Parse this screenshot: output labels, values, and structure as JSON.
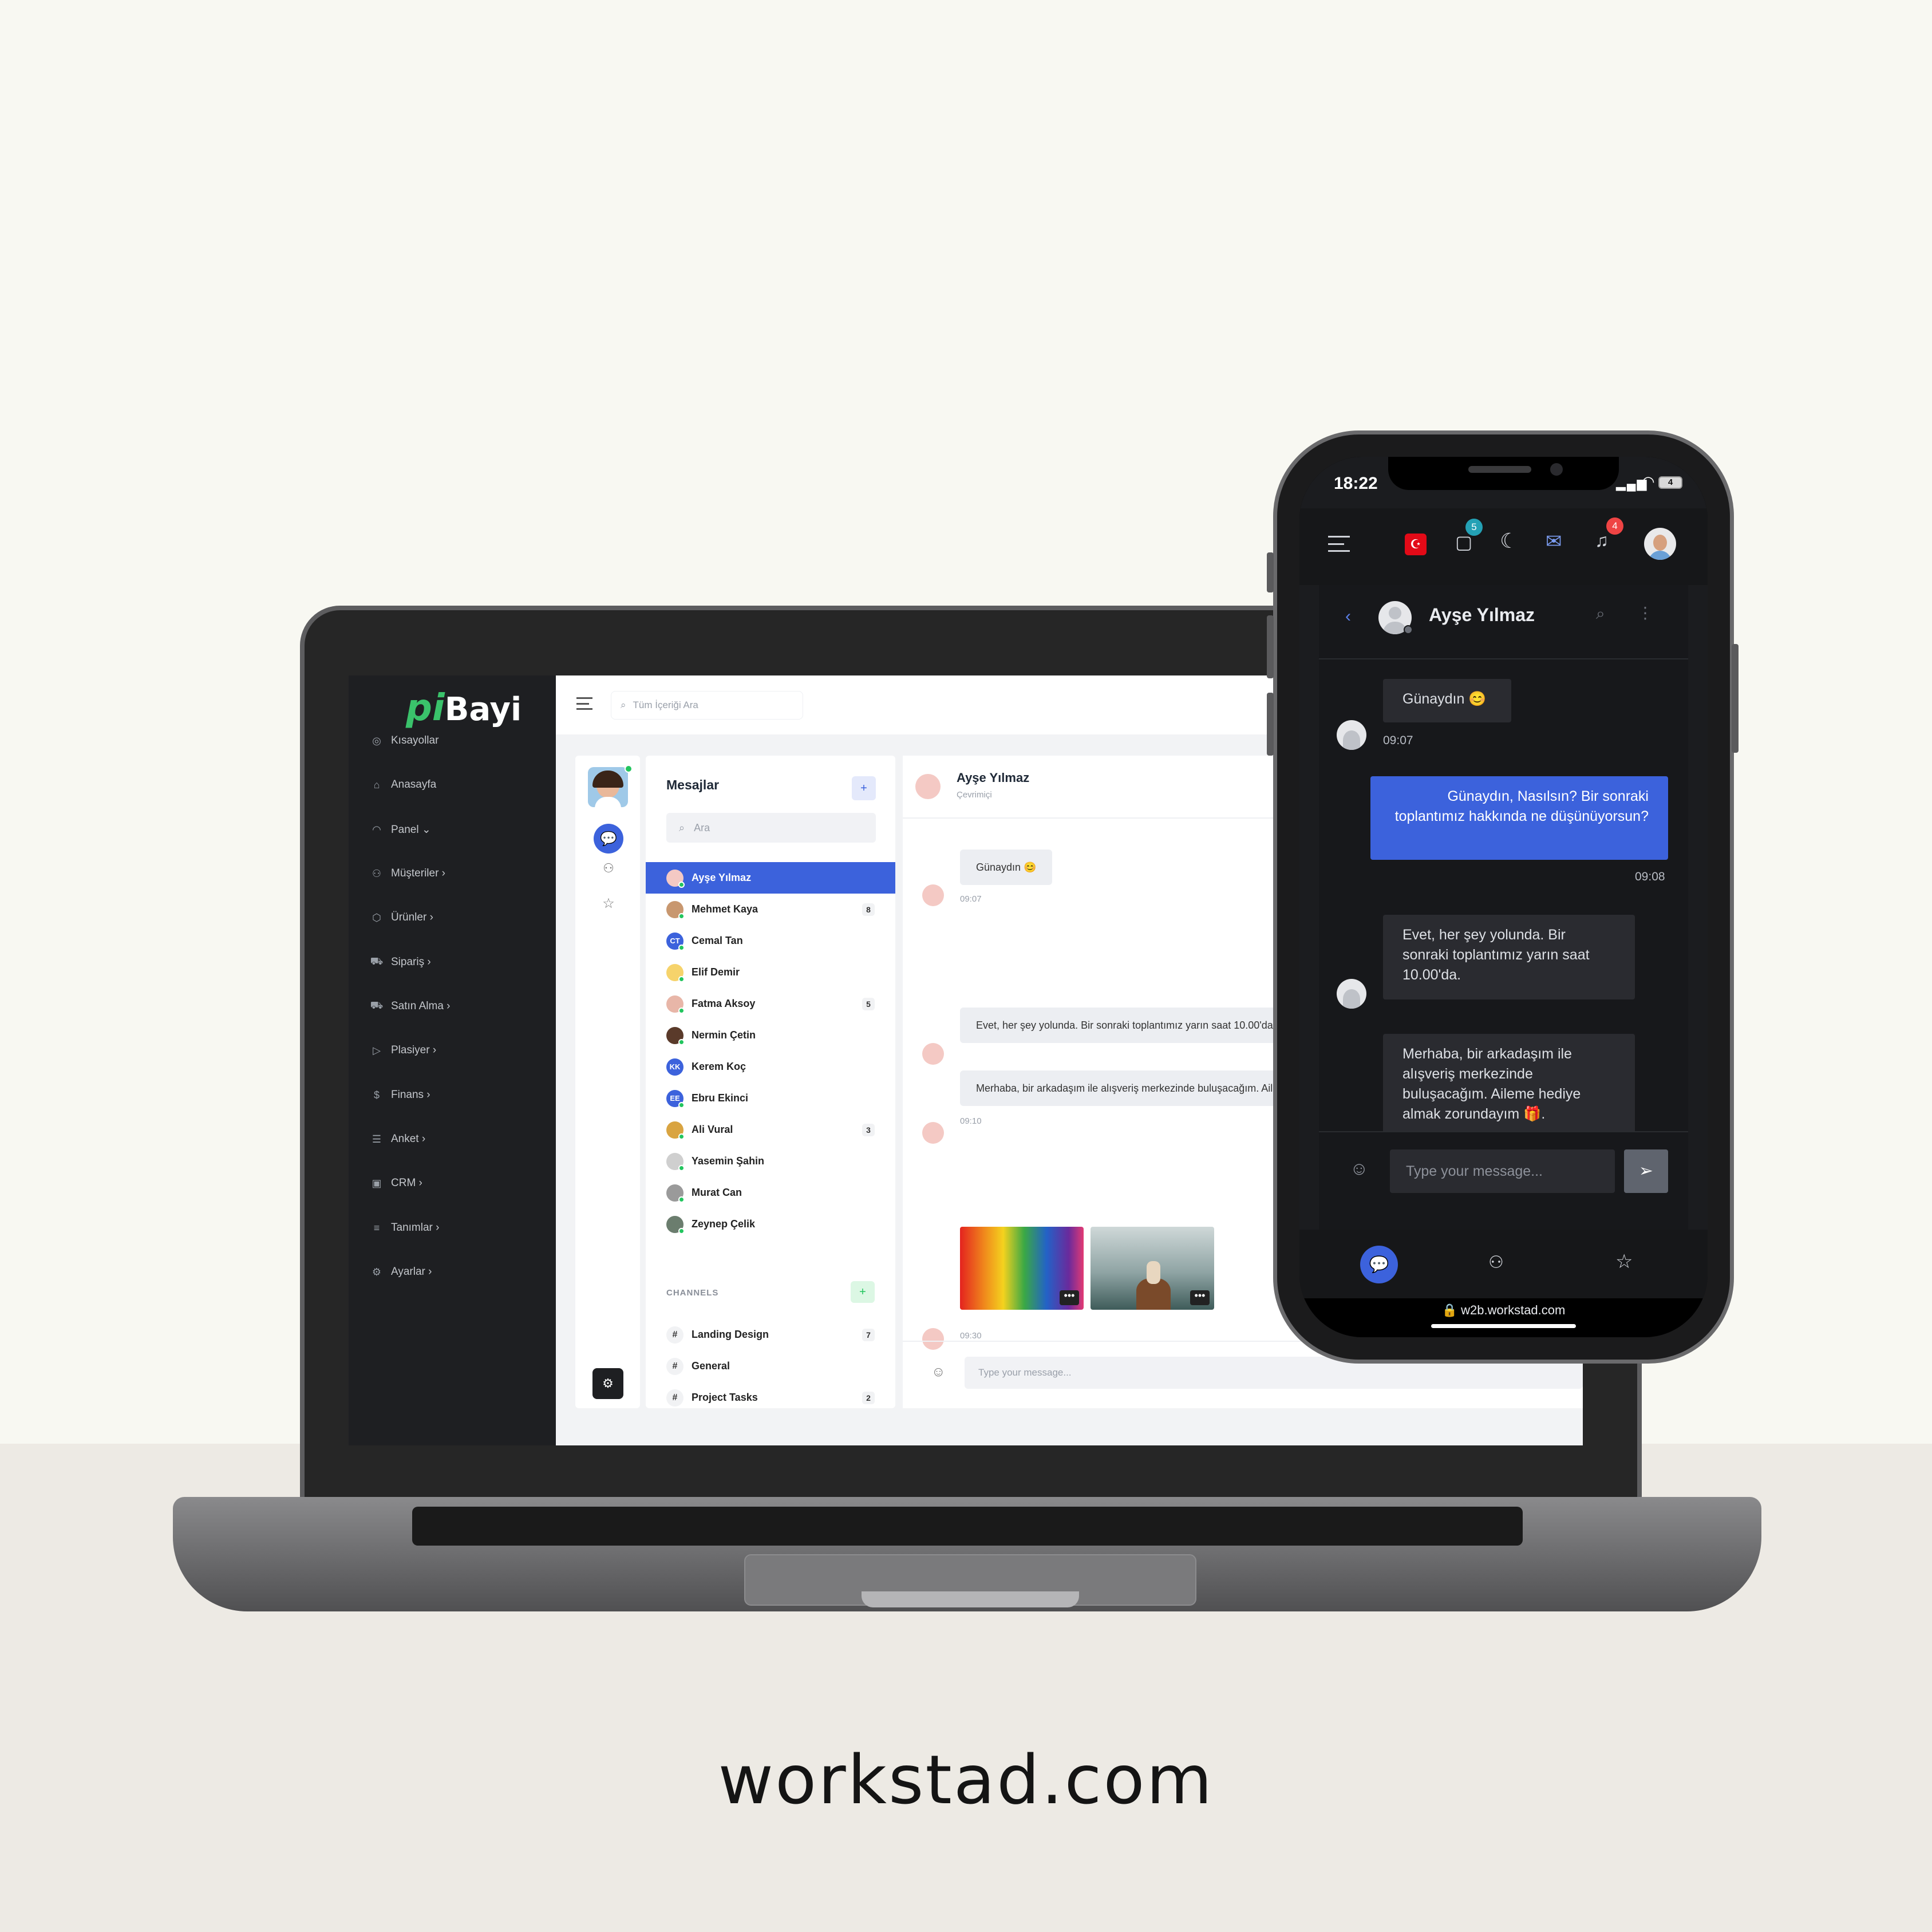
{
  "brand_url": "workstad.com",
  "laptop": {
    "logo": {
      "pi": "pi",
      "bayi": "Bayi"
    },
    "nav": [
      {
        "label": "Kısayollar",
        "icon": "bulb-icon"
      },
      {
        "label": "Anasayfa",
        "icon": "home-icon"
      },
      {
        "label": "Panel ⌄",
        "icon": "gauge-icon"
      },
      {
        "label": "Müşteriler ›",
        "icon": "users-icon"
      },
      {
        "label": "Ürünler ›",
        "icon": "box-icon"
      },
      {
        "label": "Sipariş ›",
        "icon": "cart-icon"
      },
      {
        "label": "Satın Alma ›",
        "icon": "cart-icon"
      },
      {
        "label": "Plasiyer ›",
        "icon": "flag-icon"
      },
      {
        "label": "Finans ›",
        "icon": "dollar-icon"
      },
      {
        "label": "Anket ›",
        "icon": "list-icon"
      },
      {
        "label": "CRM ›",
        "icon": "briefcase-icon"
      },
      {
        "label": "Tanımlar ›",
        "icon": "lines-icon"
      },
      {
        "label": "Ayarlar ›",
        "icon": "gear-icon"
      }
    ],
    "search_placeholder": "Tüm İçeriği Ara",
    "messages_title": "Mesajlar",
    "list_search_placeholder": "Ara",
    "contacts": [
      {
        "name": "Ayşe Yılmaz",
        "count": "",
        "initials": ""
      },
      {
        "name": "Mehmet Kaya",
        "count": "8",
        "initials": ""
      },
      {
        "name": "Cemal Tan",
        "count": "",
        "initials": "CT"
      },
      {
        "name": "Elif Demir",
        "count": "",
        "initials": ""
      },
      {
        "name": "Fatma Aksoy",
        "count": "5",
        "initials": ""
      },
      {
        "name": "Nermin Çetin",
        "count": "",
        "initials": ""
      },
      {
        "name": "Kerem Koç",
        "count": "",
        "initials": "KK"
      },
      {
        "name": "Ebru Ekinci",
        "count": "",
        "initials": "EE"
      },
      {
        "name": "Ali Vural",
        "count": "3",
        "initials": ""
      },
      {
        "name": "Yasemin Şahin",
        "count": "",
        "initials": ""
      },
      {
        "name": "Murat Can",
        "count": "",
        "initials": ""
      },
      {
        "name": "Zeynep Çelik",
        "count": "",
        "initials": ""
      }
    ],
    "channels_title": "CHANNELS",
    "channels": [
      {
        "name": "Landing Design",
        "count": "7"
      },
      {
        "name": "General",
        "count": ""
      },
      {
        "name": "Project Tasks",
        "count": "2"
      }
    ],
    "chat": {
      "name": "Ayşe Yılmaz",
      "status": "Çevrimiçi",
      "msg1": "Günaydın 😊",
      "time1": "09:07",
      "msg2": "Evet, her şey yolunda. Bir sonraki toplantımız yarın saat 10.00'da.",
      "msg3": "Merhaba, bir arkadaşım ile alışveriş merkezinde buluşacağım. Aileme hediye almak zorundayım 🎁.",
      "time3": "09:10",
      "time4": "09:30",
      "input_placeholder": "Type your message..."
    }
  },
  "phone": {
    "time": "18:22",
    "battery": "4",
    "cart_badge": "5",
    "bell_badge": "4",
    "chat_name": "Ayşe Yılmaz",
    "msg1": "Günaydın 😊",
    "time1": "09:07",
    "msg2": "Günaydın, Nasılsın? Bir sonraki toplantımız hakkında ne düşünüyorsun?",
    "time2": "09:08",
    "msg3": "Evet, her şey yolunda. Bir sonraki toplantımız yarın saat 10.00'da.",
    "msg4": "Merhaba, bir arkadaşım ile alışveriş merkezinde buluşacağım. Aileme hediye almak zorundayım 🎁.",
    "input_placeholder": "Type your message...",
    "url": "w2b.workstad.com"
  },
  "colors": {
    "accent": "#3c62dc",
    "brand_green": "#3ac26b",
    "sidebar": "#1e1f22",
    "phone_bg": "#17171a"
  }
}
